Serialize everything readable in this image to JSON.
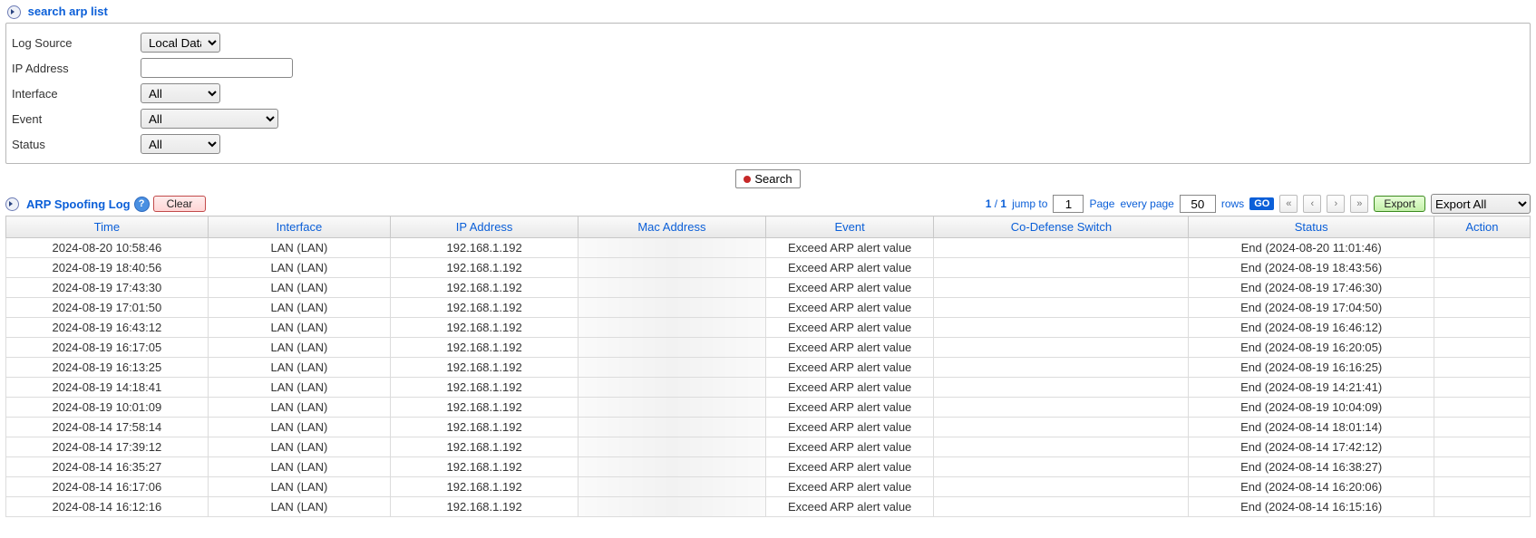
{
  "search_panel": {
    "title": "search arp list",
    "fields": {
      "log_source": {
        "label": "Log Source",
        "selected": "Local Data"
      },
      "ip_address": {
        "label": "IP Address",
        "value": ""
      },
      "interface": {
        "label": "Interface",
        "selected": "All"
      },
      "event": {
        "label": "Event",
        "selected": "All"
      },
      "status": {
        "label": "Status",
        "selected": "All"
      }
    },
    "search_button": "Search"
  },
  "log_panel": {
    "title": "ARP Spoofing Log",
    "clear_button": "Clear"
  },
  "pager": {
    "page_current": "1",
    "page_total": "1",
    "jump_label": "jump to",
    "jump_value": "1",
    "page_word": "Page",
    "every_page": "every page",
    "rows_value": "50",
    "rows_word": "rows",
    "go": "GO",
    "export": "Export",
    "export_mode": "Export All"
  },
  "table": {
    "headers": {
      "time": "Time",
      "interface": "Interface",
      "ip": "IP Address",
      "mac": "Mac Address",
      "event": "Event",
      "codef": "Co-Defense Switch",
      "status": "Status",
      "action": "Action"
    },
    "rows": [
      {
        "time": "2024-08-20 10:58:46",
        "interface": "LAN (LAN)",
        "ip": "192.168.1.192",
        "mac": "",
        "event": "Exceed ARP alert value",
        "codef": "",
        "status": "End (2024-08-20 11:01:46)",
        "action": ""
      },
      {
        "time": "2024-08-19 18:40:56",
        "interface": "LAN (LAN)",
        "ip": "192.168.1.192",
        "mac": "",
        "event": "Exceed ARP alert value",
        "codef": "",
        "status": "End (2024-08-19 18:43:56)",
        "action": ""
      },
      {
        "time": "2024-08-19 17:43:30",
        "interface": "LAN (LAN)",
        "ip": "192.168.1.192",
        "mac": "",
        "event": "Exceed ARP alert value",
        "codef": "",
        "status": "End (2024-08-19 17:46:30)",
        "action": ""
      },
      {
        "time": "2024-08-19 17:01:50",
        "interface": "LAN (LAN)",
        "ip": "192.168.1.192",
        "mac": "",
        "event": "Exceed ARP alert value",
        "codef": "",
        "status": "End (2024-08-19 17:04:50)",
        "action": ""
      },
      {
        "time": "2024-08-19 16:43:12",
        "interface": "LAN (LAN)",
        "ip": "192.168.1.192",
        "mac": "",
        "event": "Exceed ARP alert value",
        "codef": "",
        "status": "End (2024-08-19 16:46:12)",
        "action": ""
      },
      {
        "time": "2024-08-19 16:17:05",
        "interface": "LAN (LAN)",
        "ip": "192.168.1.192",
        "mac": "",
        "event": "Exceed ARP alert value",
        "codef": "",
        "status": "End (2024-08-19 16:20:05)",
        "action": ""
      },
      {
        "time": "2024-08-19 16:13:25",
        "interface": "LAN (LAN)",
        "ip": "192.168.1.192",
        "mac": "",
        "event": "Exceed ARP alert value",
        "codef": "",
        "status": "End (2024-08-19 16:16:25)",
        "action": ""
      },
      {
        "time": "2024-08-19 14:18:41",
        "interface": "LAN (LAN)",
        "ip": "192.168.1.192",
        "mac": "",
        "event": "Exceed ARP alert value",
        "codef": "",
        "status": "End (2024-08-19 14:21:41)",
        "action": ""
      },
      {
        "time": "2024-08-19 10:01:09",
        "interface": "LAN (LAN)",
        "ip": "192.168.1.192",
        "mac": "",
        "event": "Exceed ARP alert value",
        "codef": "",
        "status": "End (2024-08-19 10:04:09)",
        "action": ""
      },
      {
        "time": "2024-08-14 17:58:14",
        "interface": "LAN (LAN)",
        "ip": "192.168.1.192",
        "mac": "",
        "event": "Exceed ARP alert value",
        "codef": "",
        "status": "End (2024-08-14 18:01:14)",
        "action": ""
      },
      {
        "time": "2024-08-14 17:39:12",
        "interface": "LAN (LAN)",
        "ip": "192.168.1.192",
        "mac": "",
        "event": "Exceed ARP alert value",
        "codef": "",
        "status": "End (2024-08-14 17:42:12)",
        "action": ""
      },
      {
        "time": "2024-08-14 16:35:27",
        "interface": "LAN (LAN)",
        "ip": "192.168.1.192",
        "mac": "",
        "event": "Exceed ARP alert value",
        "codef": "",
        "status": "End (2024-08-14 16:38:27)",
        "action": ""
      },
      {
        "time": "2024-08-14 16:17:06",
        "interface": "LAN (LAN)",
        "ip": "192.168.1.192",
        "mac": "",
        "event": "Exceed ARP alert value",
        "codef": "",
        "status": "End (2024-08-14 16:20:06)",
        "action": ""
      },
      {
        "time": "2024-08-14 16:12:16",
        "interface": "LAN (LAN)",
        "ip": "192.168.1.192",
        "mac": "",
        "event": "Exceed ARP alert value",
        "codef": "",
        "status": "End (2024-08-14 16:15:16)",
        "action": ""
      }
    ]
  }
}
